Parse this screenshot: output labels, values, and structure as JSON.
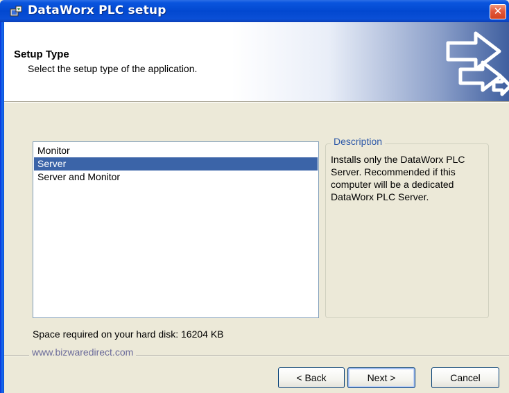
{
  "window": {
    "title": "DataWorx PLC setup",
    "close_label": "✕"
  },
  "banner": {
    "title": "Setup Type",
    "subtitle": "Select the setup type of the application.",
    "graphic_icon": "arrows-icon"
  },
  "setup_types": {
    "items": [
      {
        "label": "Monitor",
        "selected": false
      },
      {
        "label": "Server",
        "selected": true
      },
      {
        "label": "Server and Monitor",
        "selected": false
      }
    ]
  },
  "description": {
    "legend": "Description",
    "text": "Installs only the DataWorx PLC Server.  Recommended if this computer will be a dedicated DataWorx PLC Server."
  },
  "space_required": "Space required on your hard disk: 16204 KB",
  "footer": {
    "link": "www.bizwaredirect.com"
  },
  "buttons": {
    "back": "< Back",
    "next": "Next >",
    "cancel": "Cancel"
  },
  "colors": {
    "titlebar": "#0a55de",
    "selection": "#3b64a8",
    "dialog_bg": "#ece9d8",
    "legend_text": "#2e59a8"
  }
}
